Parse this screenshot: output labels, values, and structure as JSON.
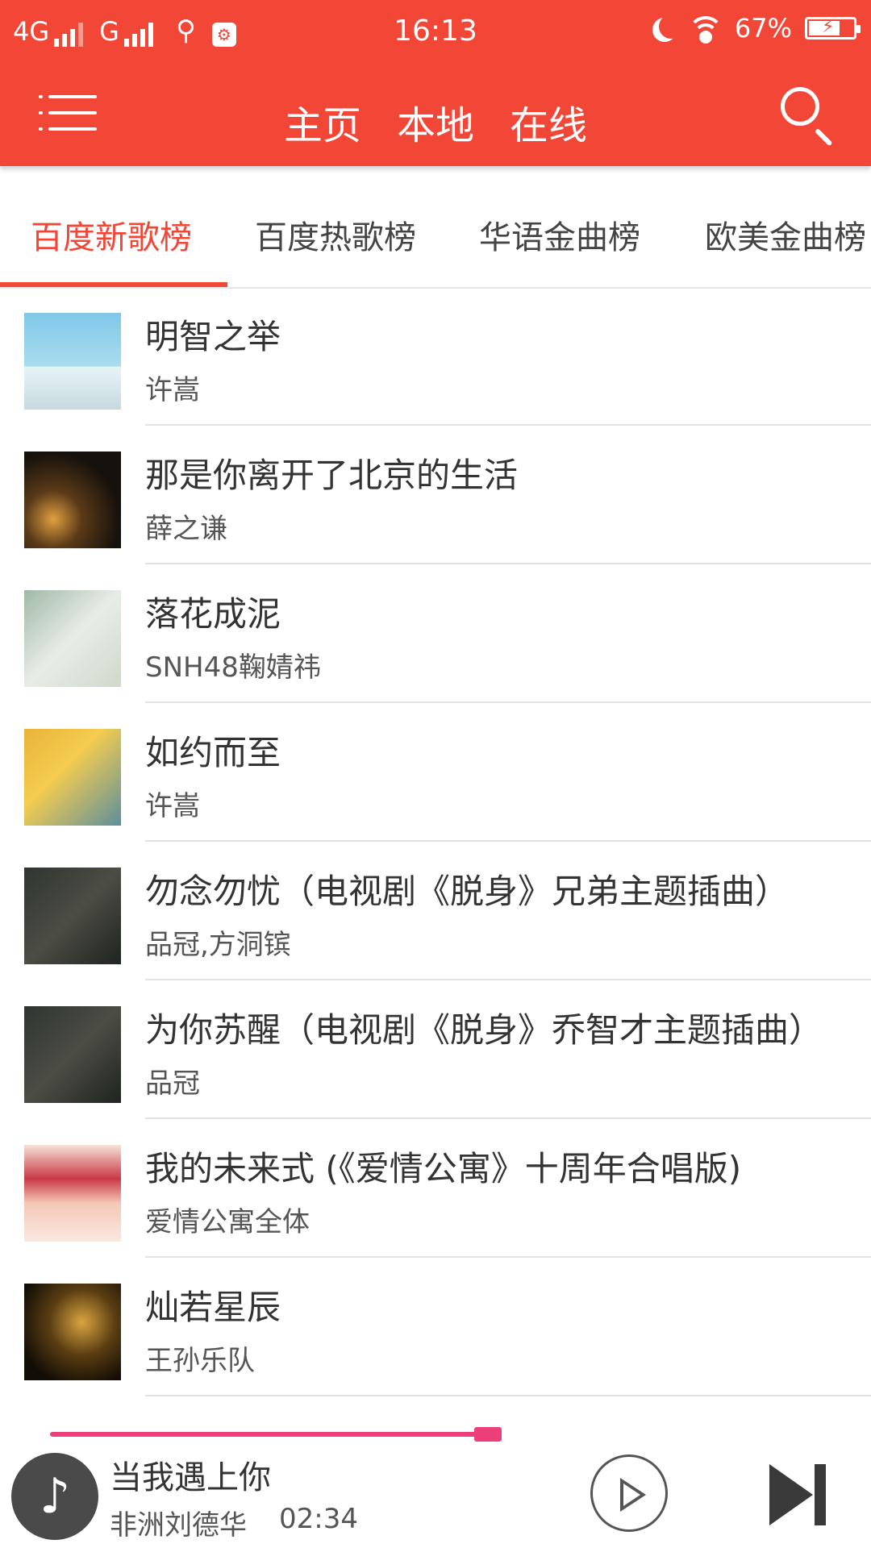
{
  "status_bar": {
    "network1": "4G",
    "network2": "G",
    "time": "16:13",
    "battery": "67%"
  },
  "header": {
    "tabs": [
      "主页",
      "本地",
      "在线"
    ]
  },
  "chart_tabs": {
    "items": [
      "百度新歌榜",
      "百度热歌榜",
      "华语金曲榜",
      "欧美金曲榜"
    ],
    "active_index": 0
  },
  "songs": [
    {
      "title": "明智之举",
      "artist": "许嵩"
    },
    {
      "title": "那是你离开了北京的生活",
      "artist": "薛之谦"
    },
    {
      "title": "落花成泥",
      "artist": "SNH48鞠婧祎"
    },
    {
      "title": "如约而至",
      "artist": "许嵩"
    },
    {
      "title": "勿念勿忧（电视剧《脱身》兄弟主题插曲）",
      "artist": "品冠,方洞镔"
    },
    {
      "title": "为你苏醒（电视剧《脱身》乔智才主题插曲）",
      "artist": "品冠"
    },
    {
      "title": "我的未来式 (《爱情公寓》十周年合唱版)",
      "artist": "爱情公寓全体"
    },
    {
      "title": "灿若星辰",
      "artist": "王孙乐队"
    }
  ],
  "player": {
    "title": "当我遇上你",
    "artist": "非洲刘德华",
    "time": "02:34",
    "progress": 0.47
  },
  "colors": {
    "accent": "#f24636",
    "progress": "#ec3f7a"
  },
  "icons": [
    "menu-icon",
    "search-icon",
    "music-note-icon",
    "play-icon",
    "skip-next-icon"
  ]
}
